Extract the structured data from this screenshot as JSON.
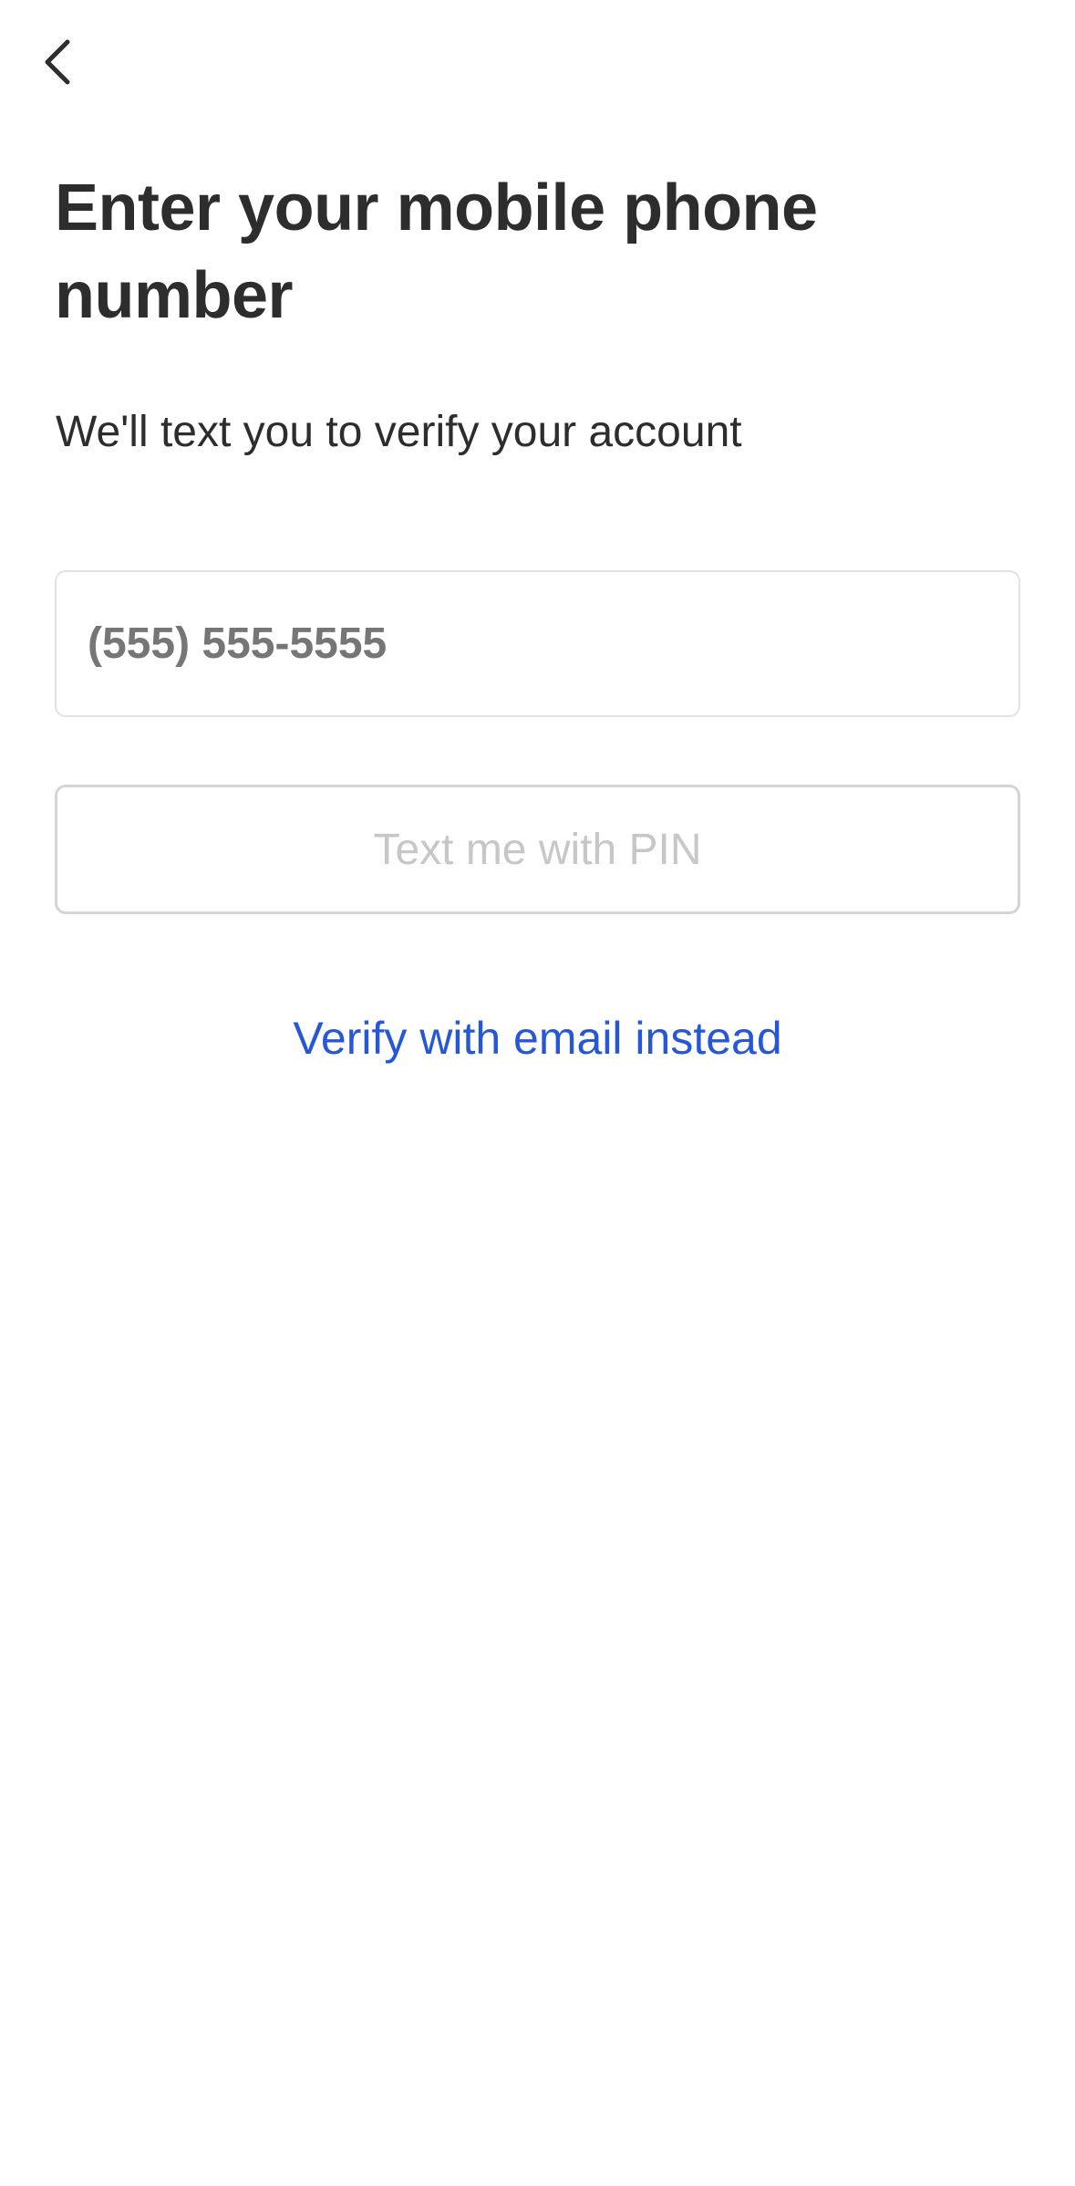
{
  "header": {
    "back_icon": "chevron-left-icon"
  },
  "main": {
    "title": "Enter your mobile phone number",
    "subtitle": "We'll text you to verify your account",
    "phone_input": {
      "value": "",
      "placeholder": "(555) 555-5555"
    },
    "pin_button_label": "Text me with PIN",
    "email_link_label": "Verify with email instead"
  },
  "colors": {
    "text": "#2d2d2d",
    "placeholder": "#767676",
    "disabled_text": "#c7c7c7",
    "link": "#2557d6",
    "border": "#e3e3e3"
  }
}
